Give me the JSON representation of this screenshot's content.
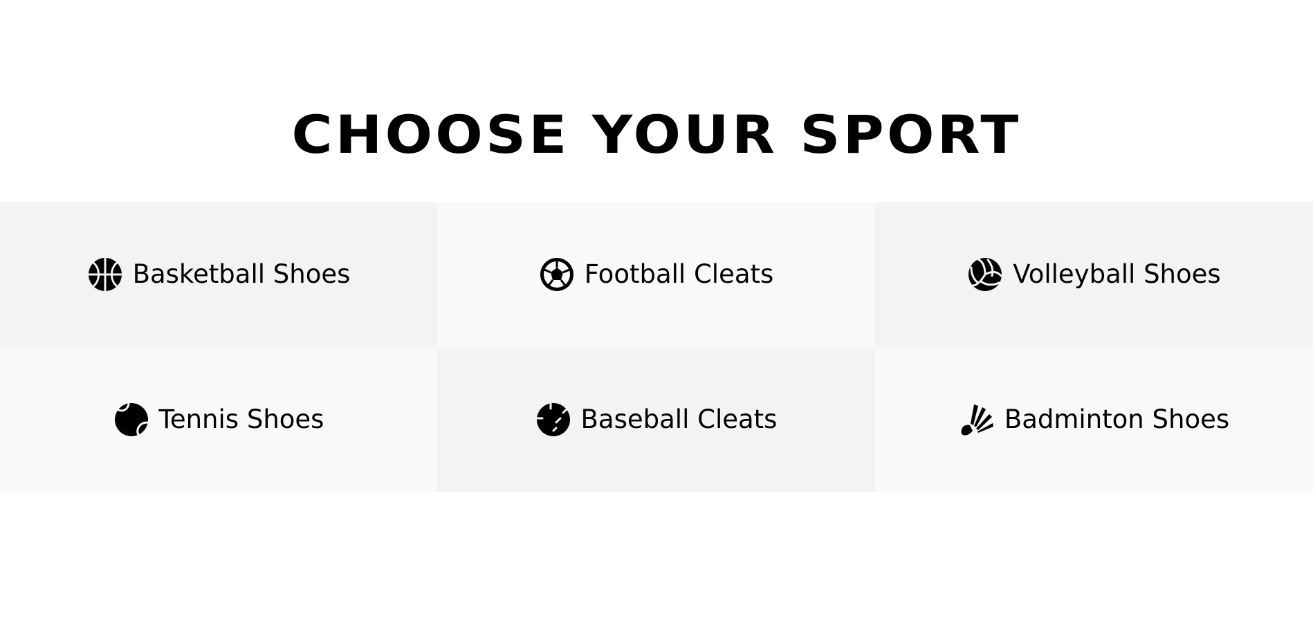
{
  "header": {
    "title": "CHOOSE YOUR SPORT"
  },
  "sports": [
    {
      "label": "Basketball Shoes",
      "icon": "basketball-icon"
    },
    {
      "label": "Football Cleats",
      "icon": "soccer-ball-icon"
    },
    {
      "label": "Volleyball Shoes",
      "icon": "volleyball-icon"
    },
    {
      "label": "Tennis Shoes",
      "icon": "tennis-ball-icon"
    },
    {
      "label": "Baseball Cleats",
      "icon": "baseball-icon"
    },
    {
      "label": "Badminton Shoes",
      "icon": "shuttlecock-icon"
    }
  ],
  "colors": {
    "background": "#ffffff",
    "tile_dark": "#f2f3f5",
    "tile_light": "#f8f9fa",
    "text": "#000000"
  }
}
